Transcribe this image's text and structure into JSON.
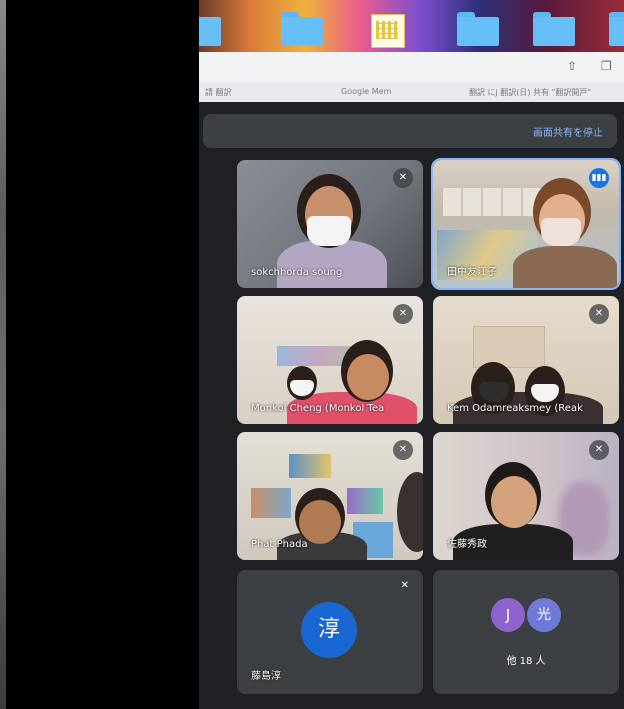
{
  "desktop": {
    "icons": [
      "folder-icon",
      "folder-icon",
      "spreadsheet-icon",
      "folder-icon",
      "folder-icon",
      "folder-icon"
    ]
  },
  "browser": {
    "bookmarks": [
      "請 翻訳",
      "Google Mem",
      "翻訳 にj 翻訳(日) 共有 \"翻訳開戸\""
    ]
  },
  "meet": {
    "share_stop_label": "画面共有を停止",
    "participants": [
      {
        "name": "sokchhorda soung",
        "muted": true
      },
      {
        "name": "田中友江子",
        "muted": false,
        "speaking": true
      },
      {
        "name": "Monkol Cheng (Monkol Tea",
        "muted": true
      },
      {
        "name": "Kem Odamreaksmey (Reak",
        "muted": true
      },
      {
        "name": "Phat Phada",
        "muted": true
      },
      {
        "name": "佐藤秀政",
        "muted": true
      },
      {
        "name": "藤島淳",
        "muted": true,
        "avatar_initial": "淳",
        "avatar_color": "#1967d2"
      }
    ],
    "others": {
      "label": "他 18 人",
      "avatars": [
        {
          "initial": "J",
          "color": "#8e63ce"
        },
        {
          "initial": "光",
          "color": "#6e7ad6"
        }
      ]
    }
  }
}
